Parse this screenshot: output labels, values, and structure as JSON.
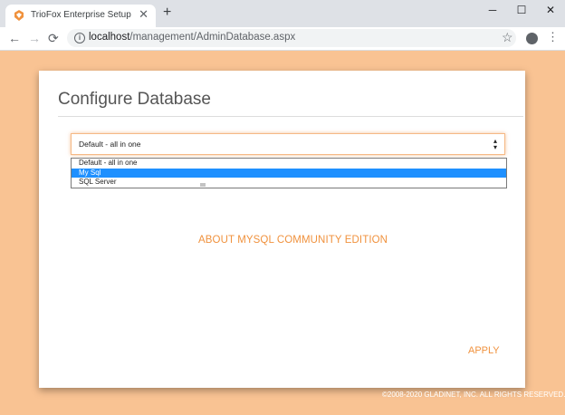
{
  "browser": {
    "tab": {
      "title": "TrioFox Enterprise Setup",
      "close": "✕"
    },
    "new_tab": "+",
    "window": {
      "minimize": "─",
      "maximize": "☐",
      "close": "✕"
    },
    "toolbar": {
      "back": "←",
      "forward": "→",
      "reload": "⟳",
      "url_host": "localhost",
      "url_path": "/management/AdminDatabase.aspx",
      "star": "☆",
      "menu": "⋮"
    }
  },
  "page": {
    "title": "Configure Database",
    "select": {
      "value": "Default - all in one",
      "arrow": "▴▾",
      "options": [
        "Default - all in one",
        "My Sql",
        "SQL Server"
      ],
      "highlighted": "My Sql"
    },
    "about_link": "ABOUT MYSQL COMMUNITY EDITION",
    "apply": "APPLY",
    "footer": "©2008-2020 GLADINET, INC. ALL RIGHTS RESERVED."
  },
  "colors": {
    "background": "#f9c393",
    "accent": "#f0923e",
    "highlight": "#1e90ff",
    "tabstrip": "#dee1e6"
  }
}
